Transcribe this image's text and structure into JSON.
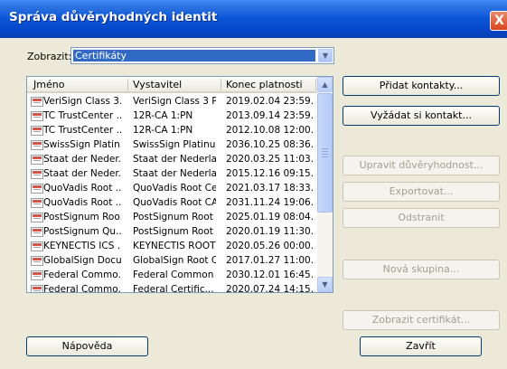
{
  "window": {
    "title": "Správa důvěryhodných identit",
    "close_glyph": "X"
  },
  "show": {
    "label": "Zobrazit:",
    "value": "Certifikáty"
  },
  "list": {
    "columns": [
      "Jméno",
      "Vystavitel",
      "Konec platnosti"
    ],
    "rows": [
      [
        "VeriSign Class 3...",
        "VeriSign Class 3 P...",
        "2019.02.04 23:59..."
      ],
      [
        "TC TrustCenter ...",
        "12R-CA 1:PN",
        "2013.09.14 23:59..."
      ],
      [
        "TC TrustCenter ...",
        "12R-CA 1:PN",
        "2012.10.08 12:00..."
      ],
      [
        "SwissSign Platin...",
        "SwissSign Platinum...",
        "2036.10.25 08:36..."
      ],
      [
        "Staat der Neder...",
        "Staat der Nederla...",
        "2020.03.25 11:03..."
      ],
      [
        "Staat der Neder...",
        "Staat der Nederla...",
        "2015.12.16 09:15..."
      ],
      [
        "QuoVadis Root ...",
        "QuoVadis Root Ce...",
        "2021.03.17 18:33..."
      ],
      [
        "QuoVadis Root ...",
        "QuoVadis Root CA 3",
        "2031.11.24 19:06..."
      ],
      [
        "PostSignum Roo...",
        "PostSignum Root ...",
        "2025.01.19 08:04..."
      ],
      [
        "PostSignum Qu...",
        "PostSignum Root ...",
        "2020.01.19 11:30..."
      ],
      [
        "KEYNECTIS ICS ...",
        "KEYNECTIS ROOT ...",
        "2020.05.26 00:00..."
      ],
      [
        "GlobalSign Docu...",
        "GlobalSign Root CA",
        "2017.01.27 11:00..."
      ],
      [
        "Federal Commo...",
        "Federal Common P...",
        "2030.12.01 16:45..."
      ],
      [
        "Federal Commo...",
        "Federal Certific...",
        "2020.07.24 14:15..."
      ]
    ]
  },
  "buttons": {
    "add_contacts": "Přidat kontakty...",
    "request_contact": "Vyžádat si kontakt...",
    "edit_trust": "Upravit důvěryhodnost...",
    "export": "Exportovat...",
    "remove": "Odstranit",
    "new_group": "Nová skupina...",
    "show_certificate": "Zobrazit certifikát...",
    "help": "Nápověda",
    "close": "Zavřít"
  },
  "colors": {
    "title_bar": "#0a55d8",
    "selection": "#316ac5",
    "dialog_bg": "#ece9d8"
  }
}
